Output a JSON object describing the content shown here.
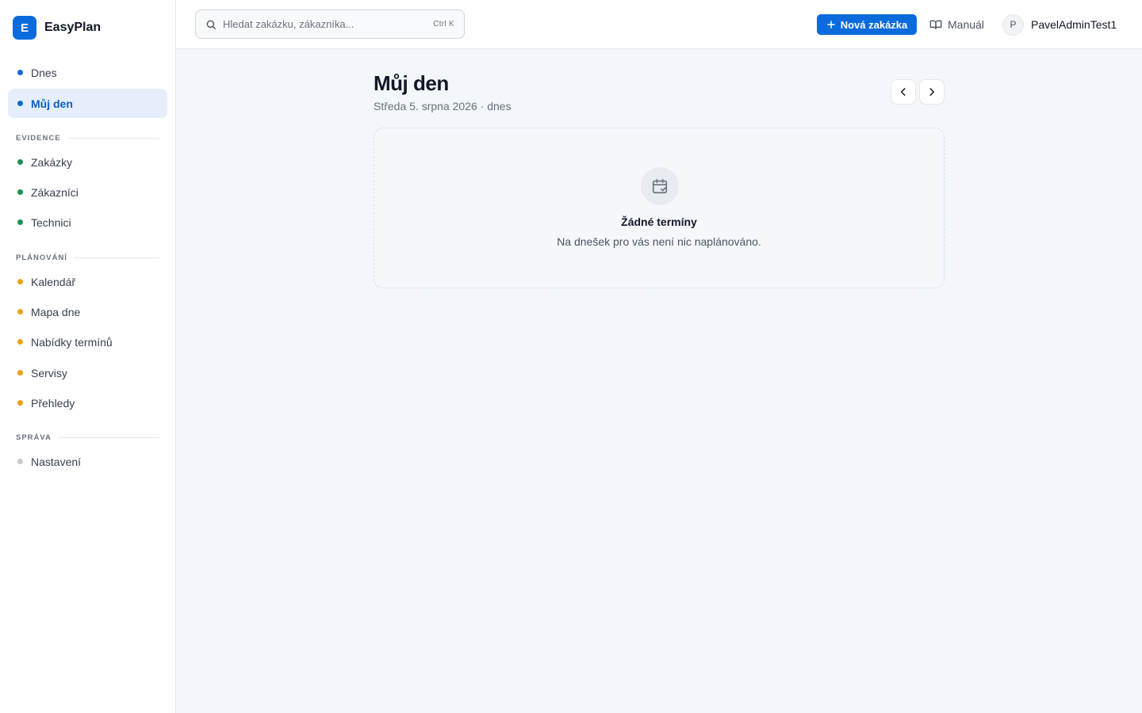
{
  "brand": {
    "logo_letter": "E",
    "name": "EasyPlan"
  },
  "sidebar": {
    "top_items": [
      {
        "label": "Dnes",
        "color": "#0b6bdc"
      },
      {
        "label": "Můj den",
        "color": "#0b6bdc",
        "active": true
      }
    ],
    "sections": [
      {
        "label": "EVIDENCE",
        "items": [
          {
            "label": "Zakázky",
            "color": "#16924f"
          },
          {
            "label": "Zákazníci",
            "color": "#16924f"
          },
          {
            "label": "Technici",
            "color": "#16924f"
          }
        ]
      },
      {
        "label": "PLÁNOVÁNÍ",
        "items": [
          {
            "label": "Kalendář",
            "color": "#eda211"
          },
          {
            "label": "Mapa dne",
            "color": "#eda211"
          },
          {
            "label": "Nabídky termínů",
            "color": "#eda211"
          },
          {
            "label": "Servisy",
            "color": "#eda211"
          },
          {
            "label": "Přehledy",
            "color": "#eda211"
          }
        ]
      },
      {
        "label": "SPRÁVA",
        "items": [
          {
            "label": "Nastavení",
            "color": "#c7ccd4"
          }
        ]
      }
    ]
  },
  "topbar": {
    "search": {
      "placeholder": "Hledat zakázku, zákazníka...",
      "shortcut": "Ctrl K",
      "icon": "search-icon"
    },
    "new_order_label": "Nová zakázka",
    "manual_label": "Manuál",
    "user": {
      "avatar_letter": "P",
      "name": "PavelAdminTest1"
    }
  },
  "main": {
    "title": "Můj den",
    "subtitle": "Středa 5. srpna 2026 · dnes",
    "empty_state": {
      "title": "Žádné termíny",
      "text": "Na dnešek pro vás není nic naplánováno.",
      "icon": "calendar-check-icon"
    }
  },
  "colors": {
    "accent": "#0b6bdc"
  }
}
